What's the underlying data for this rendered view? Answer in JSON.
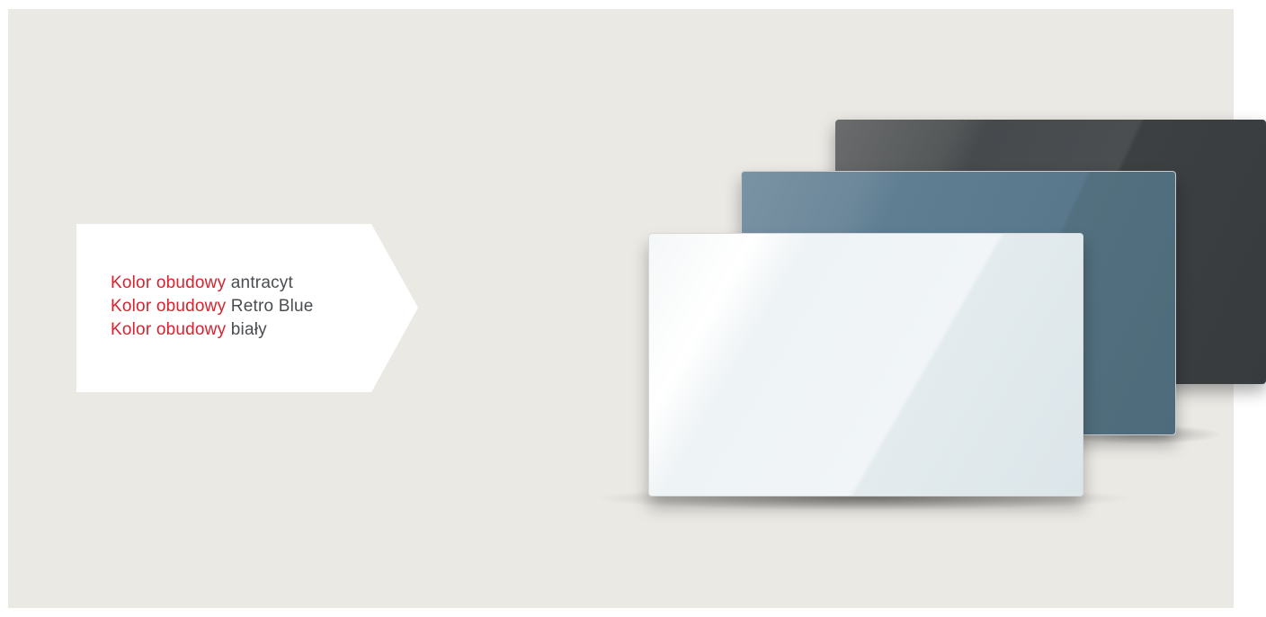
{
  "callout": {
    "items": [
      {
        "label": "Kolor obudowy",
        "value": "antracyt"
      },
      {
        "label": "Kolor obudowy",
        "value": "Retro Blue"
      },
      {
        "label": "Kolor obudowy",
        "value": "biały"
      }
    ]
  },
  "colors": {
    "background": "#ebe9e4",
    "label_accent": "#d8222e",
    "value_text": "#4a4d52",
    "callout_fill": "#ffffff",
    "panel_antracyt": "#45494c",
    "panel_retro_blue": "#5d7b8f",
    "panel_white": "#f1f5f7"
  }
}
